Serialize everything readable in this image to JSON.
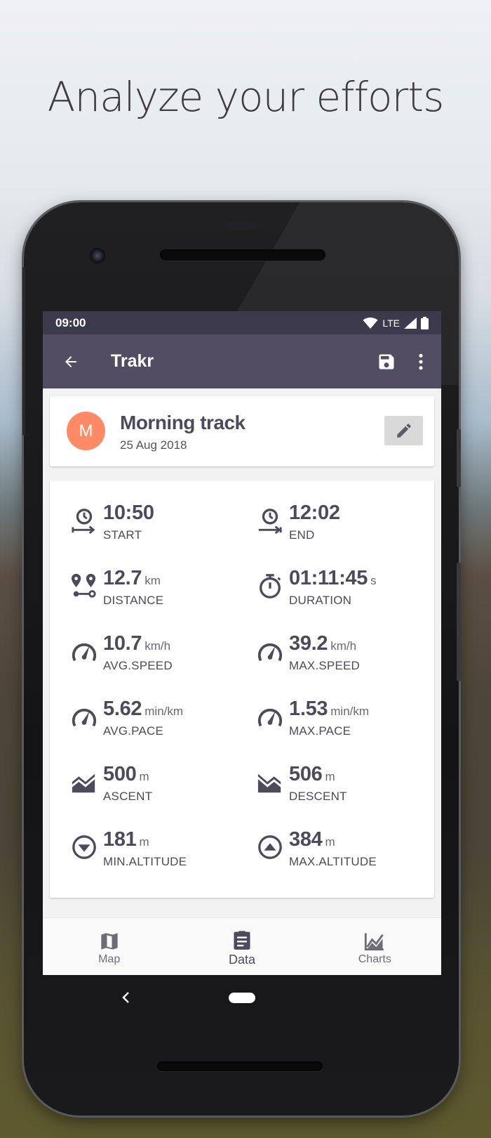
{
  "headline": "Analyze your efforts",
  "status_bar": {
    "time": "09:00",
    "network": "LTE"
  },
  "app_bar": {
    "title": "Trakr"
  },
  "track": {
    "avatar_letter": "M",
    "name": "Morning track",
    "date": "25 Aug 2018"
  },
  "stats": [
    {
      "value": "10:50",
      "unit": "",
      "label": "START",
      "icon": "clock-start-icon"
    },
    {
      "value": "12:02",
      "unit": "",
      "label": "END",
      "icon": "clock-end-icon"
    },
    {
      "value": "12.7",
      "unit": "km",
      "label": "DISTANCE",
      "icon": "route-icon"
    },
    {
      "value": "01:11:45",
      "unit": "s",
      "label": "DURATION",
      "icon": "stopwatch-icon"
    },
    {
      "value": "10.7",
      "unit": "km/h",
      "label": "AVG.SPEED",
      "icon": "speedometer-icon"
    },
    {
      "value": "39.2",
      "unit": "km/h",
      "label": "MAX.SPEED",
      "icon": "speedometer-icon"
    },
    {
      "value": "5.62",
      "unit": "min/km",
      "label": "AVG.PACE",
      "icon": "speedometer-icon"
    },
    {
      "value": "1.53",
      "unit": "min/km",
      "label": "MAX.PACE",
      "icon": "speedometer-icon"
    },
    {
      "value": "500",
      "unit": "m",
      "label": "ASCENT",
      "icon": "ascent-icon"
    },
    {
      "value": "506",
      "unit": "m",
      "label": "DESCENT",
      "icon": "descent-icon"
    },
    {
      "value": "181",
      "unit": "m",
      "label": "MIN.ALTITUDE",
      "icon": "arrow-down-circle-icon"
    },
    {
      "value": "384",
      "unit": "m",
      "label": "MAX.ALTITUDE",
      "icon": "arrow-up-circle-icon"
    }
  ],
  "bottom_nav": [
    {
      "label": "Map",
      "icon": "map-icon",
      "active": false
    },
    {
      "label": "Data",
      "icon": "clipboard-icon",
      "active": true
    },
    {
      "label": "Charts",
      "icon": "chart-icon",
      "active": false
    }
  ],
  "colors": {
    "app_bar": "#524d62",
    "status_bar": "#3e3a4e",
    "avatar": "#ff8a65",
    "text_primary": "#4d4a5d"
  }
}
